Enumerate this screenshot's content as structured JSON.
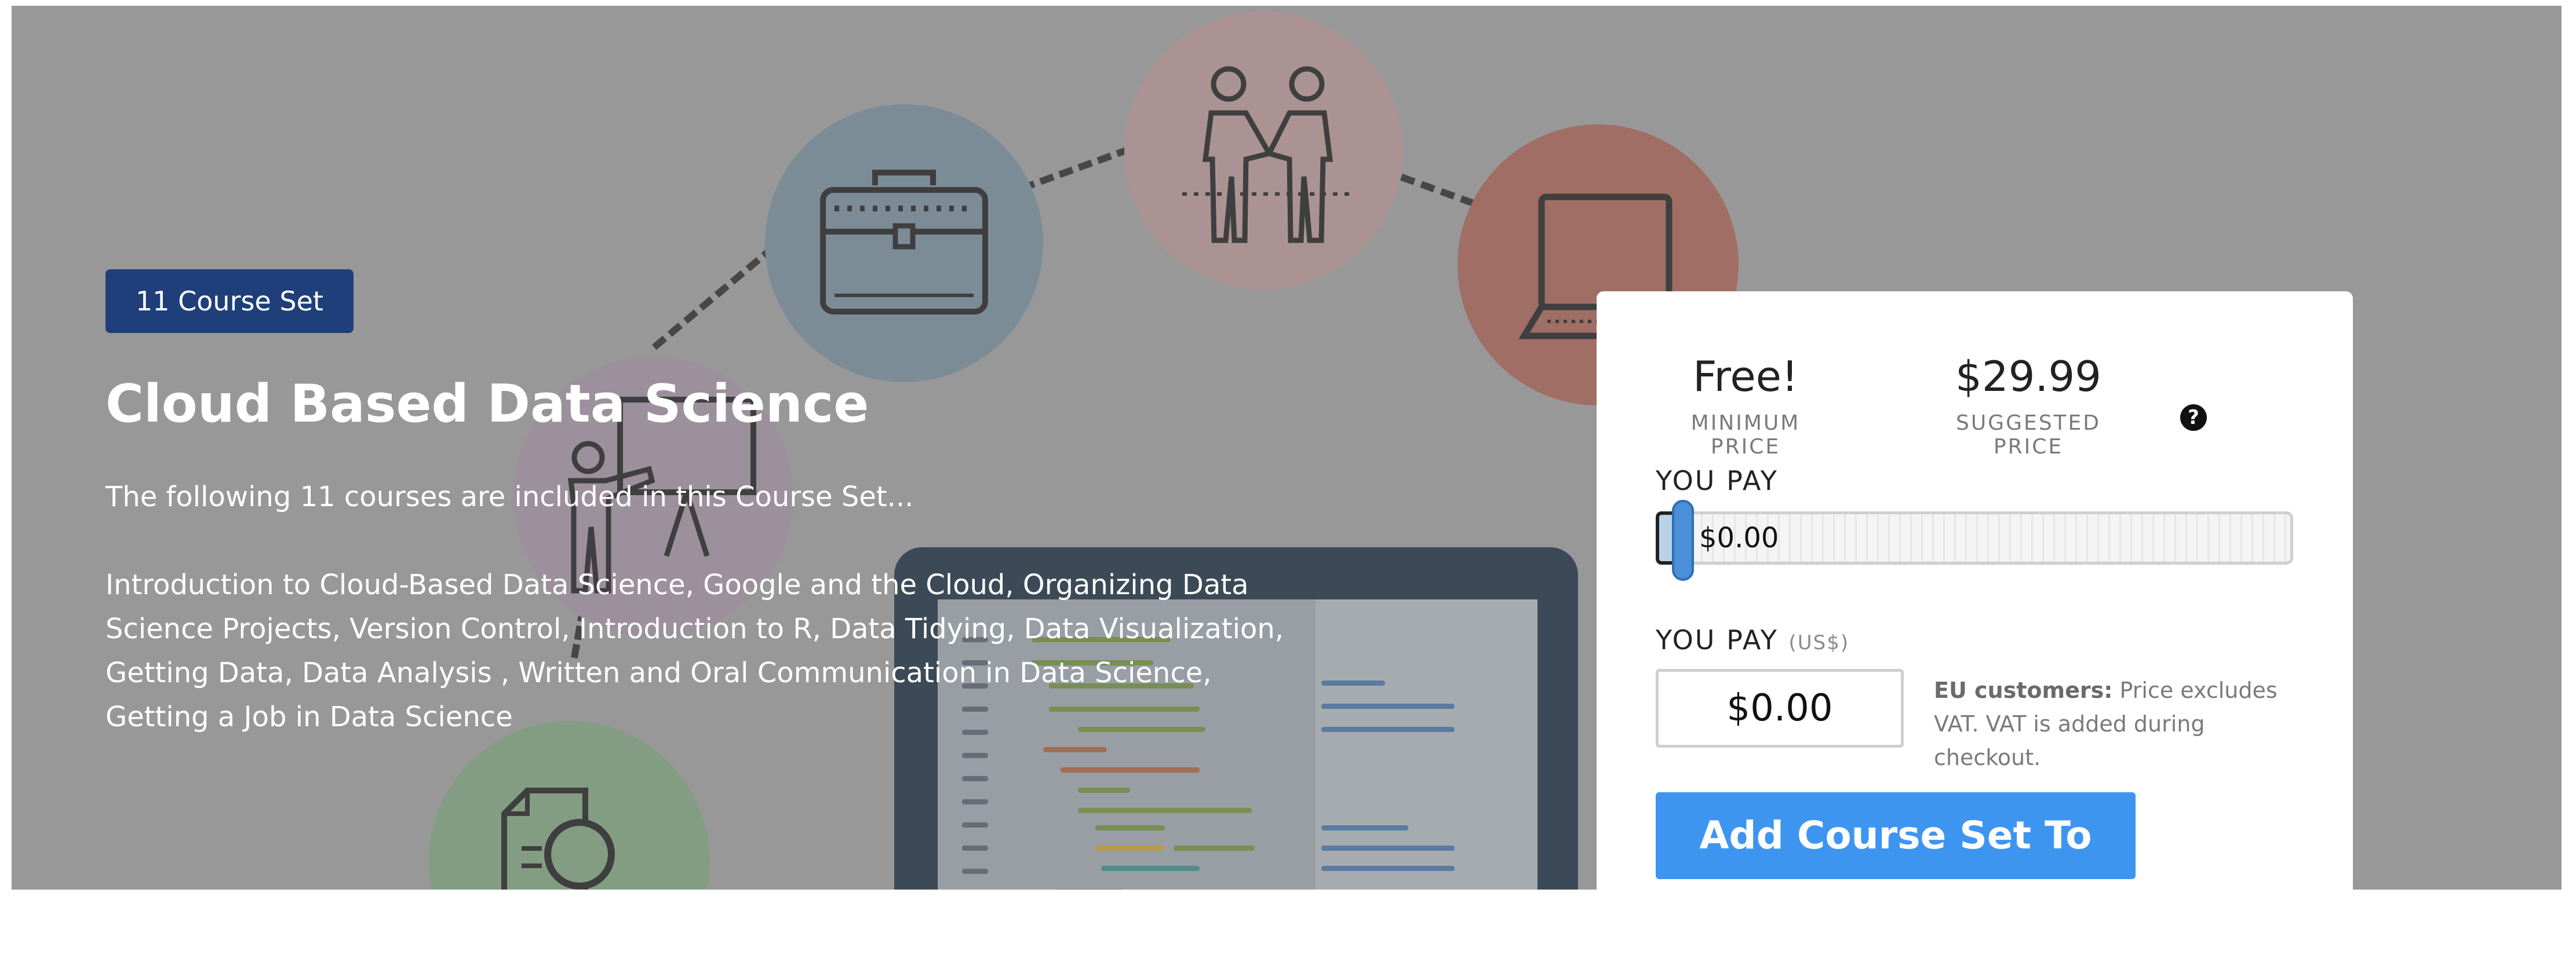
{
  "hero": {
    "badge": "11 Course Set",
    "title": "Cloud Based Data Science",
    "intro": "The following 11 courses are included in this Course Set...",
    "course_list": "Introduction to Cloud-Based Data Science, Google and the Cloud, Organizing Data Science Projects, Version Control, Introduction to R, Data Tidying, Data Visualization, Getting Data, Data Analysis , Written and Oral Communication in Data Science, Getting a Job in Data Science"
  },
  "illustration": {
    "icons": [
      "briefcase-icon",
      "handshake-icon",
      "laptop-icon",
      "presenter-icon",
      "document-search-icon",
      "code-monitor-icon"
    ],
    "colors": {
      "background": "#9a9a9a",
      "briefcase_circle": "#6f8799",
      "handshake_circle": "#b89292",
      "laptop_circle": "#a6594a",
      "presenter_circle": "#a08ea0",
      "document_circle": "#7aa17a",
      "monitor": "#0d2135"
    }
  },
  "pricing": {
    "minimum_price": "Free!",
    "minimum_label": "MINIMUM PRICE",
    "suggested_price": "$29.99",
    "suggested_label": "SUGGESTED PRICE",
    "help_icon": "?",
    "slider_label": "YOU PAY",
    "slider_value": "$0.00",
    "slider_fraction": 0,
    "input_label": "YOU PAY",
    "input_unit": "(US$)",
    "input_value": "$0.00",
    "vat_bold": "EU customers:",
    "vat_text": " Price excludes VAT. VAT is added during checkout.",
    "button_label": "Add Course Set To Cart",
    "accent_color": "#3d95f0"
  }
}
